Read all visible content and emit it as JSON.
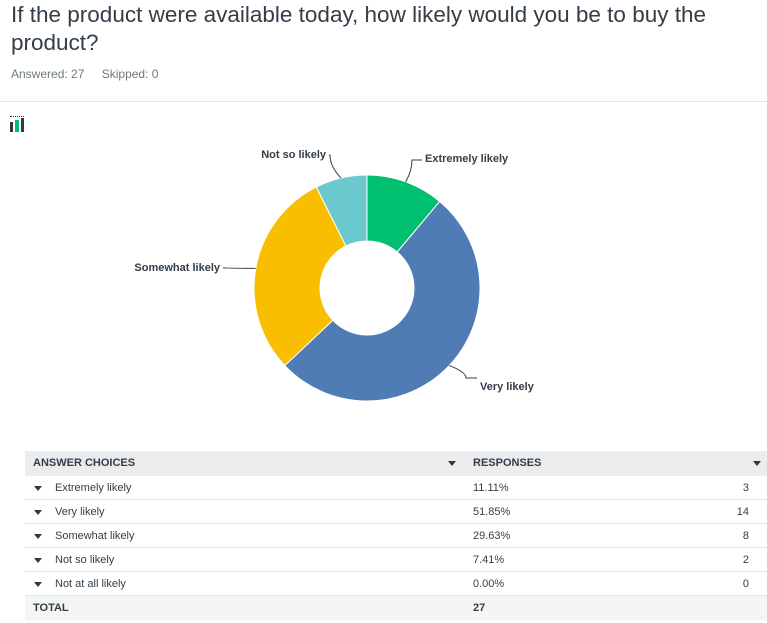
{
  "question": "If the product were available today, how likely would you be to buy the product?",
  "meta": {
    "answered": "Answered: 27",
    "skipped": "Skipped: 0"
  },
  "icons": {
    "chart_toggle": "bar-chart-icon",
    "sort": "chevron-down-icon"
  },
  "colors": {
    "extremely": "#00bf6f",
    "very": "#507cb6",
    "somewhat": "#f9be00",
    "not_so": "#6bc8cd"
  },
  "chart_data": {
    "type": "pie",
    "style": "donut",
    "categories": [
      "Extremely likely",
      "Very likely",
      "Somewhat likely",
      "Not so likely",
      "Not at all likely"
    ],
    "values": [
      11.11,
      51.85,
      29.63,
      7.41,
      0.0
    ],
    "colors": [
      "#00bf6f",
      "#507cb6",
      "#f9be00",
      "#6bc8cd",
      "#bbbbbb"
    ],
    "labels_shown": [
      "Extremely likely",
      "Very likely",
      "Somewhat likely",
      "Not so likely"
    ]
  },
  "table": {
    "headers": {
      "choices": "ANSWER CHOICES",
      "responses": "RESPONSES"
    },
    "rows": [
      {
        "label": "Extremely likely",
        "pct": "11.11%",
        "count": "3"
      },
      {
        "label": "Very likely",
        "pct": "51.85%",
        "count": "14"
      },
      {
        "label": "Somewhat likely",
        "pct": "29.63%",
        "count": "8"
      },
      {
        "label": "Not so likely",
        "pct": "7.41%",
        "count": "2"
      },
      {
        "label": "Not at all likely",
        "pct": "0.00%",
        "count": "0"
      }
    ],
    "total_label": "TOTAL",
    "total_value": "27"
  }
}
